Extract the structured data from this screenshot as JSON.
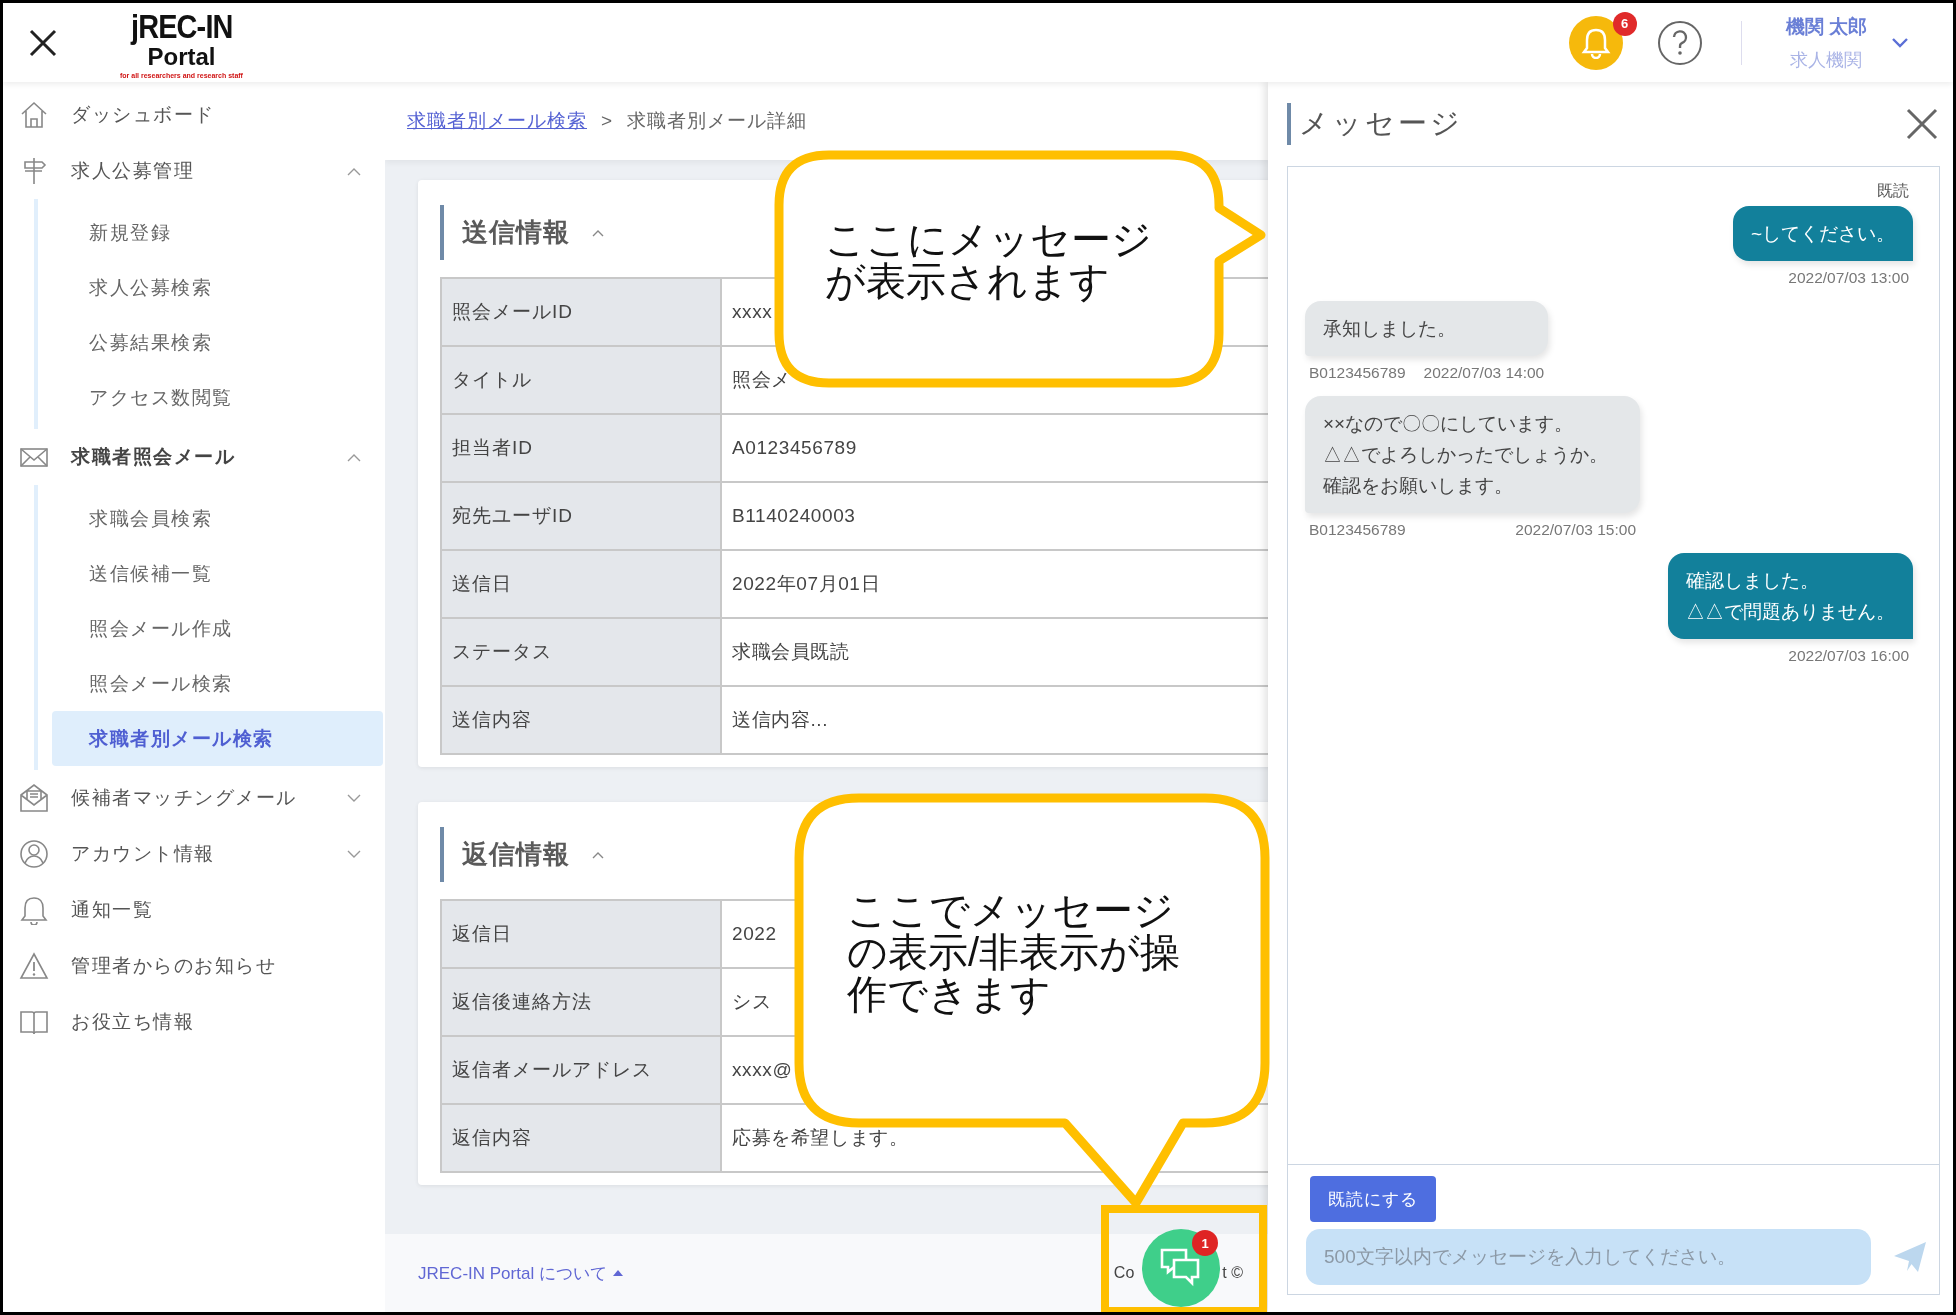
{
  "header": {
    "logo": {
      "title": "jREC-IN",
      "subtitle": "Portal",
      "tagline": "for all researchers and research staff"
    },
    "notifications": {
      "count": "6"
    },
    "user": {
      "name": "機関 太郎",
      "role": "求人機関"
    }
  },
  "sidebar": {
    "items": [
      {
        "label": "ダッシュボード",
        "selected": false
      },
      {
        "label": "求人公募管理",
        "selected": false,
        "expanded": true,
        "children": [
          {
            "label": "新規登録",
            "selected": false
          },
          {
            "label": "求人公募検索",
            "selected": false
          },
          {
            "label": "公募結果検索",
            "selected": false
          },
          {
            "label": "アクセス数閲覧",
            "selected": false
          }
        ]
      },
      {
        "label": "求職者照会メール",
        "selected": false,
        "expanded": true,
        "children": [
          {
            "label": "求職会員検索",
            "selected": false
          },
          {
            "label": "送信候補一覧",
            "selected": false
          },
          {
            "label": "照会メール作成",
            "selected": false
          },
          {
            "label": "照会メール検索",
            "selected": false
          },
          {
            "label": "求職者別メール検索",
            "selected": true
          }
        ]
      },
      {
        "label": "候補者マッチングメール",
        "selected": false,
        "expanded": false
      },
      {
        "label": "アカウント情報",
        "selected": false,
        "expanded": false
      },
      {
        "label": "通知一覧",
        "selected": false
      },
      {
        "label": "管理者からのお知らせ",
        "selected": false
      },
      {
        "label": "お役立ち情報",
        "selected": false
      }
    ]
  },
  "breadcrumb": {
    "separator": ">",
    "items": [
      {
        "label": "求職者別メール検索",
        "link": true
      },
      {
        "label": "求職者別メール詳細",
        "link": false
      }
    ]
  },
  "sections": [
    {
      "title": "送信情報",
      "expanded": true,
      "rows": [
        {
          "label": "照会メールID",
          "value": "xxxx"
        },
        {
          "label": "タイトル",
          "value": "照会メ"
        },
        {
          "label": "担当者ID",
          "value": "A0123456789"
        },
        {
          "label": "宛先ユーザID",
          "value": "B1140240003"
        },
        {
          "label": "送信日",
          "value": "2022年07月01日"
        },
        {
          "label": "ステータス",
          "value": "求職会員既読"
        },
        {
          "label": "送信内容",
          "value": "送信内容..."
        }
      ]
    },
    {
      "title": "返信情報",
      "expanded": true,
      "rows": [
        {
          "label": "返信日",
          "value": "2022"
        },
        {
          "label": "返信後連絡方法",
          "value": "シス"
        },
        {
          "label": "返信者メールアドレス",
          "value": "xxxx@"
        },
        {
          "label": "返信内容",
          "value": "応募を希望します。"
        }
      ]
    }
  ],
  "footer": {
    "about_link": "JREC-IN Portal について",
    "copyright_fragments": [
      "Co",
      "t ©"
    ]
  },
  "chat_button": {
    "badge": "1"
  },
  "message_panel": {
    "title": "メッセージ",
    "messages": [
      {
        "kind": "sent",
        "status": "既読",
        "lines": [
          "~してください。"
        ],
        "time": "2022/07/03 13:00"
      },
      {
        "kind": "received",
        "lines": [
          "承知しました。"
        ],
        "sender": "B0123456789",
        "time": "2022/07/03 14:00"
      },
      {
        "kind": "received",
        "lines": [
          "××なので〇〇にしています。",
          "△△でよろしかったでしょうか。",
          "確認をお願いします。"
        ],
        "sender": "B0123456789",
        "time": "2022/07/03 15:00"
      },
      {
        "kind": "sent",
        "lines": [
          "確認しました。",
          "△△で問題ありません。"
        ],
        "time": "2022/07/03 16:00"
      }
    ],
    "mark_read_button": "既読にする",
    "input": {
      "placeholder": "500文字以内でメッセージを入力してください。"
    }
  },
  "callouts": [
    {
      "text": "ここにメッセージが表示されます"
    },
    {
      "text": "ここでメッセージの表示/非表示が操作できます"
    }
  ]
}
